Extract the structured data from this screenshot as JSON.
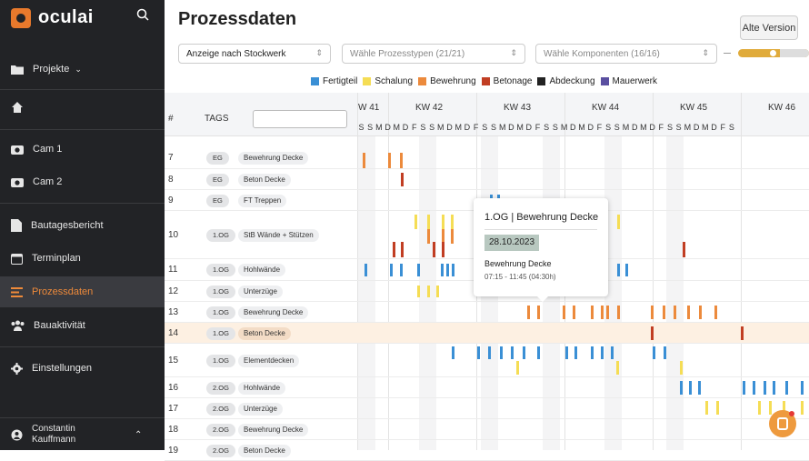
{
  "app": {
    "logo": "oculai"
  },
  "sidebar": {
    "projects": "Projekte",
    "items": [
      {
        "key": "cam1",
        "label": "Cam 1",
        "icon": "camera-icon"
      },
      {
        "key": "cam2",
        "label": "Cam 2",
        "icon": "camera-icon"
      },
      {
        "key": "bautagesbericht",
        "label": "Bautagesbericht",
        "icon": "document-icon"
      },
      {
        "key": "terminplan",
        "label": "Terminplan",
        "icon": "calendar-icon"
      },
      {
        "key": "prozessdaten",
        "label": "Prozessdaten",
        "icon": "list-icon",
        "active": true
      },
      {
        "key": "bauaktivitaet",
        "label": "Bauaktivität",
        "icon": "people-icon"
      },
      {
        "key": "einstellungen",
        "label": "Einstellungen",
        "icon": "gear-icon"
      }
    ],
    "user_first": "Constantin",
    "user_last": "Kauffmann"
  },
  "header": {
    "title": "Prozessdaten",
    "alt_version": "Alte Version"
  },
  "filters": {
    "floor": "Anzeige nach Stockwerk",
    "process_types": "Wähle Prozesstypen (21/21)",
    "components": "Wähle Komponenten (16/16)"
  },
  "legend": [
    {
      "label": "Fertigteil",
      "color": "#3a8fd5"
    },
    {
      "label": "Schalung",
      "color": "#f5dd55"
    },
    {
      "label": "Bewehrung",
      "color": "#ec8a3c"
    },
    {
      "label": "Betonage",
      "color": "#c13e23"
    },
    {
      "label": "Abdeckung",
      "color": "#222222"
    },
    {
      "label": "Mauerwerk",
      "color": "#5a4fa0"
    }
  ],
  "table": {
    "col_num": "#",
    "col_tags": "TAGS"
  },
  "weeks": [
    "W 41",
    "KW 42",
    "KW 43",
    "KW 44",
    "KW 45",
    "KW 46"
  ],
  "day_letters": "SSMDMDFSSMDMDFSSMDMDFSSMDMDFSSMDMDFSSMDMDFS",
  "rows": [
    {
      "num": "7",
      "tag": "EG",
      "name": "Bewehrung Decke"
    },
    {
      "num": "8",
      "tag": "EG",
      "name": "Beton Decke"
    },
    {
      "num": "9",
      "tag": "EG",
      "name": "FT Treppen"
    },
    {
      "num": "10",
      "tag": "1.OG",
      "name": "StB Wände + Stützen"
    },
    {
      "num": "11",
      "tag": "1.OG",
      "name": "Hohlwände"
    },
    {
      "num": "12",
      "tag": "1.OG",
      "name": "Unterzüge"
    },
    {
      "num": "13",
      "tag": "1.OG",
      "name": "Bewehrung Decke"
    },
    {
      "num": "14",
      "tag": "1.OG",
      "name": "Beton Decke",
      "highlight": true
    },
    {
      "num": "15",
      "tag": "1.OG",
      "name": "Elementdecken"
    },
    {
      "num": "16",
      "tag": "2.OG",
      "name": "Hohlwände"
    },
    {
      "num": "17",
      "tag": "2.OG",
      "name": "Unterzüge"
    },
    {
      "num": "18",
      "tag": "2.OG",
      "name": "Bewehrung Decke"
    },
    {
      "num": "19",
      "tag": "2.OG",
      "name": "Beton Decke"
    }
  ],
  "tooltip": {
    "title": "1.OG | Bewehrung Decke",
    "date": "28.10.2023",
    "name": "Bewehrung Decke",
    "time": "07:15 - 11:45 (04:30h)"
  }
}
